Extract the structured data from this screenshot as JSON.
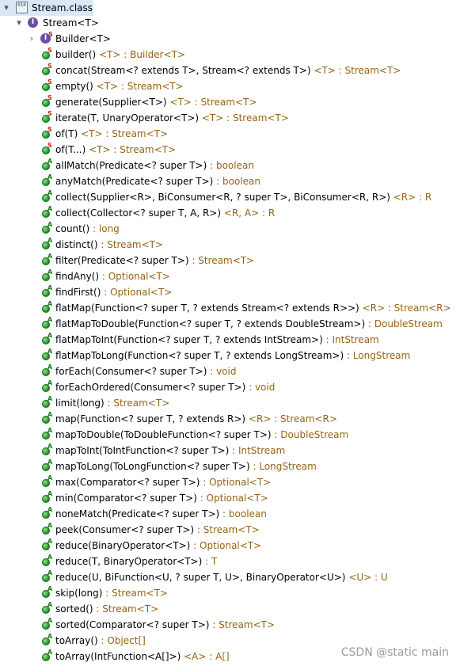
{
  "root": {
    "label": "Stream.class",
    "icon_text": "010"
  },
  "interface": {
    "label": "Stream<T>"
  },
  "nested": {
    "label": "Builder<T>"
  },
  "methods": [
    {
      "sig": "builder()",
      "ret": " <T> : Builder<T>",
      "badge": "S"
    },
    {
      "sig": "concat(Stream<? extends T>, Stream<? extends T>)",
      "ret": " <T> : Stream<T>",
      "badge": "S"
    },
    {
      "sig": "empty()",
      "ret": " <T> : Stream<T>",
      "badge": "S"
    },
    {
      "sig": "generate(Supplier<T>)",
      "ret": " <T> : Stream<T>",
      "badge": "S"
    },
    {
      "sig": "iterate(T, UnaryOperator<T>)",
      "ret": " <T> : Stream<T>",
      "badge": "S"
    },
    {
      "sig": "of(T)",
      "ret": " <T> : Stream<T>",
      "badge": "S"
    },
    {
      "sig": "of(T...)",
      "ret": " <T> : Stream<T>",
      "badge": "S"
    },
    {
      "sig": "allMatch(Predicate<? super T>)",
      "ret": " : boolean",
      "badge": "A"
    },
    {
      "sig": "anyMatch(Predicate<? super T>)",
      "ret": " : boolean",
      "badge": "A"
    },
    {
      "sig": "collect(Supplier<R>, BiConsumer<R, ? super T>, BiConsumer<R, R>)",
      "ret": " <R> : R",
      "badge": "A"
    },
    {
      "sig": "collect(Collector<? super T, A, R>)",
      "ret": " <R, A> : R",
      "badge": "A"
    },
    {
      "sig": "count()",
      "ret": " : long",
      "badge": "A"
    },
    {
      "sig": "distinct()",
      "ret": " : Stream<T>",
      "badge": "A"
    },
    {
      "sig": "filter(Predicate<? super T>)",
      "ret": " : Stream<T>",
      "badge": "A"
    },
    {
      "sig": "findAny()",
      "ret": " : Optional<T>",
      "badge": "A"
    },
    {
      "sig": "findFirst()",
      "ret": " : Optional<T>",
      "badge": "A"
    },
    {
      "sig": "flatMap(Function<? super T, ? extends Stream<? extends R>>)",
      "ret": " <R> : Stream<R>",
      "badge": "A"
    },
    {
      "sig": "flatMapToDouble(Function<? super T, ? extends DoubleStream>)",
      "ret": " : DoubleStream",
      "badge": "A"
    },
    {
      "sig": "flatMapToInt(Function<? super T, ? extends IntStream>)",
      "ret": " : IntStream",
      "badge": "A"
    },
    {
      "sig": "flatMapToLong(Function<? super T, ? extends LongStream>)",
      "ret": " : LongStream",
      "badge": "A"
    },
    {
      "sig": "forEach(Consumer<? super T>)",
      "ret": " : void",
      "badge": "A"
    },
    {
      "sig": "forEachOrdered(Consumer<? super T>)",
      "ret": " : void",
      "badge": "A"
    },
    {
      "sig": "limit(long)",
      "ret": " : Stream<T>",
      "badge": "A"
    },
    {
      "sig": "map(Function<? super T, ? extends R>)",
      "ret": " <R> : Stream<R>",
      "badge": "A"
    },
    {
      "sig": "mapToDouble(ToDoubleFunction<? super T>)",
      "ret": " : DoubleStream",
      "badge": "A"
    },
    {
      "sig": "mapToInt(ToIntFunction<? super T>)",
      "ret": " : IntStream",
      "badge": "A"
    },
    {
      "sig": "mapToLong(ToLongFunction<? super T>)",
      "ret": " : LongStream",
      "badge": "A"
    },
    {
      "sig": "max(Comparator<? super T>)",
      "ret": " : Optional<T>",
      "badge": "A"
    },
    {
      "sig": "min(Comparator<? super T>)",
      "ret": " : Optional<T>",
      "badge": "A"
    },
    {
      "sig": "noneMatch(Predicate<? super T>)",
      "ret": " : boolean",
      "badge": "A"
    },
    {
      "sig": "peek(Consumer<? super T>)",
      "ret": " : Stream<T>",
      "badge": "A"
    },
    {
      "sig": "reduce(BinaryOperator<T>)",
      "ret": " : Optional<T>",
      "badge": "A"
    },
    {
      "sig": "reduce(T, BinaryOperator<T>)",
      "ret": " : T",
      "badge": "A"
    },
    {
      "sig": "reduce(U, BiFunction<U, ? super T, U>, BinaryOperator<U>)",
      "ret": " <U> : U",
      "badge": "A"
    },
    {
      "sig": "skip(long)",
      "ret": " : Stream<T>",
      "badge": "A"
    },
    {
      "sig": "sorted()",
      "ret": " : Stream<T>",
      "badge": "A"
    },
    {
      "sig": "sorted(Comparator<? super T>)",
      "ret": " : Stream<T>",
      "badge": "A"
    },
    {
      "sig": "toArray()",
      "ret": " : Object[]",
      "badge": "A"
    },
    {
      "sig": "toArray(IntFunction<A[]>)",
      "ret": " <A> : A[]",
      "badge": "A"
    }
  ],
  "watermark": "CSDN @static main",
  "colors": {
    "return_type": "#956316",
    "static_badge": "#c02020",
    "abstract_badge": "#1c7a1c",
    "method_icon": "#1d8e1d"
  }
}
